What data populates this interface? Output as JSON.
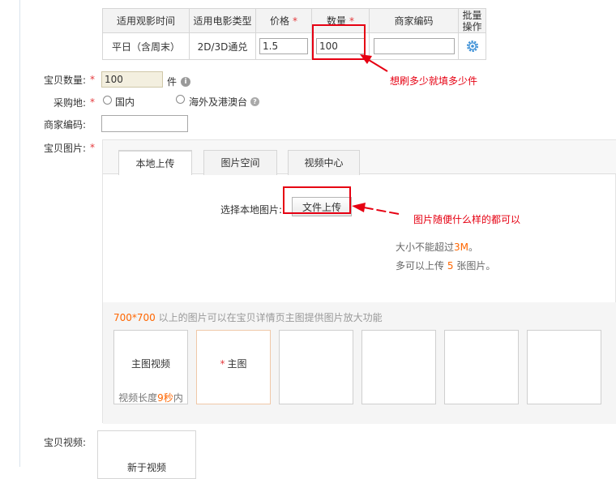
{
  "sku_table": {
    "headers": [
      "适用观影时间",
      "适用电影类型",
      "价格",
      "数量",
      "商家编码",
      "批量操作"
    ],
    "batch_header_lines": [
      "批量",
      "操作"
    ],
    "required_star": "*",
    "row": {
      "time": "平日（含周末）",
      "type": "2D/3D通兑",
      "price": "1.5",
      "quantity": "100",
      "merchant_code": ""
    }
  },
  "form": {
    "quantity_label": "宝贝数量:",
    "quantity_value": "100",
    "quantity_unit": "件",
    "purchase_label": "采购地:",
    "purchase_options": [
      "国内",
      "海外及港澳台"
    ],
    "merchant_code_label": "商家编码:",
    "merchant_code_value": "",
    "images_label": "宝贝图片:",
    "video_label": "宝贝视频:"
  },
  "uploader": {
    "tabs": [
      "本地上传",
      "图片空间",
      "视频中心"
    ],
    "active_tab": "本地上传",
    "select_label": "选择本地图片:",
    "file_button": "文件上传",
    "hint1_text": "大小不能超过",
    "hint1_value": "3M",
    "hint1_suffix": "。",
    "hint2_text": "多可以上传",
    "hint2_value": "5",
    "hint2_suffix": "张图片。",
    "thumb_tip_size": "700*700",
    "thumb_tip_text": " 以上的图片可以在宝贝详情页主图提供图片放大功能",
    "slots": {
      "video_title": "主图视频",
      "video_sub_pre": "视频长度",
      "video_sub_value": "9秒",
      "video_sub_post": "内",
      "main_star": "*",
      "main_title": "主图"
    }
  },
  "video": {
    "placeholder": "新于视频"
  },
  "annotations": {
    "quantity_note": "想刷多少就填多少件",
    "image_note": "图片随便什么样的都可以"
  },
  "colors": {
    "annotation_red": "#e60012",
    "required_red": "#e4393c",
    "accent_orange": "#ff6600"
  },
  "icons": [
    "info-icon",
    "help-icon",
    "gear-icon"
  ]
}
